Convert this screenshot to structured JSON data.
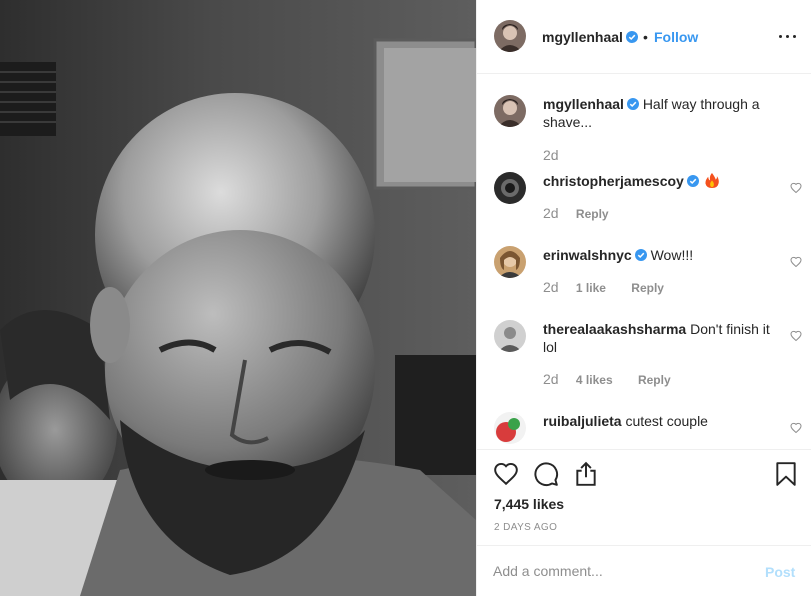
{
  "post": {
    "username": "mgyllenhaal",
    "dot": "•",
    "follow_label": "Follow",
    "more_icon": "more-horizontal-icon"
  },
  "comments": [
    {
      "username": "mgyllenhaal",
      "text": "Half way through a shave...",
      "time": "2d",
      "likes": "",
      "reply": "",
      "verified": true,
      "avatar_color": "#7d6b63"
    },
    {
      "username": "christopherjamescoy",
      "text": "",
      "emoji": "fire-emoji",
      "time": "2d",
      "likes": "",
      "reply": "Reply",
      "verified": true,
      "avatar_color": "#2b2b2b"
    },
    {
      "username": "erinwalshnyc",
      "text": "Wow!!!",
      "time": "2d",
      "likes": "1 like",
      "reply": "Reply",
      "verified": true,
      "avatar_color": "#c9a170"
    },
    {
      "username": "therealaakashsharma",
      "text": "Don't finish it lol",
      "time": "2d",
      "likes": "4 likes",
      "reply": "Reply",
      "verified": false,
      "avatar_color": "#5a5a5a"
    },
    {
      "username": "ruibaljulieta",
      "text": "cutest couple",
      "time": "",
      "likes": "",
      "reply": "",
      "verified": false,
      "avatar_color": "#d83c3c"
    }
  ],
  "actions": {
    "like_icon": "heart-icon",
    "comment_icon": "comment-icon",
    "share_icon": "share-icon",
    "save_icon": "bookmark-icon",
    "likes_count": "7,445 likes",
    "date": "2 DAYS AGO"
  },
  "add_comment": {
    "placeholder": "Add a comment...",
    "post_label": "Post"
  },
  "colors": {
    "link_blue": "#3897f0",
    "verified_blue": "#3897f0",
    "muted_gray": "#8e8e8e",
    "post_disabled": "#b2dffc"
  }
}
